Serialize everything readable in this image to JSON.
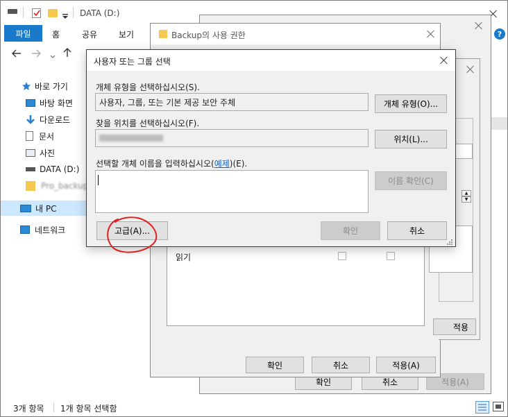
{
  "explorer": {
    "title": "DATA (D:)",
    "ribbon_tabs": [
      "파일",
      "홈",
      "공유",
      "보기"
    ],
    "nav": {
      "quick_access": "바로 가기",
      "desktop": "바탕 화면",
      "downloads": "다운로드",
      "documents": "문서",
      "pictures": "사진",
      "data_drive": "DATA (D:)",
      "backup_folder": "Pro_backup",
      "this_pc": "내 PC",
      "network": "네트워크"
    },
    "status": {
      "items": "3개 항목",
      "selected": "1개 항목 선택함"
    }
  },
  "back_window": {
    "ok": "확인",
    "cancel": "취소",
    "apply": "적용(A)"
  },
  "perm_dialog": {
    "title": "Backup의 사용 권한",
    "read_label": "읽기",
    "apply_inner": "적용",
    "ok": "확인",
    "cancel": "취소",
    "apply": "적용(A)"
  },
  "select_dialog": {
    "title": "사용자 또는 그룹 선택",
    "object_type_label": "개체 유형을 선택하십시오(S).",
    "object_type_value": "사용자, 그룹, 또는 기본 제공 보안 주체",
    "object_type_button": "개체 유형(O)...",
    "location_label": "찾을 위치를 선택하십시오(F).",
    "location_value": "",
    "location_button": "위치(L)...",
    "names_label_prefix": "선택할 개체 이름을 입력하십시오(",
    "names_label_link": "예제",
    "names_label_suffix": ")(E).",
    "names_value": "",
    "check_names_button": "이름 확인(C)",
    "advanced_button": "고급(A)...",
    "ok_button": "확인",
    "cancel_button": "취소"
  },
  "colors": {
    "accent": "#1979ca",
    "link": "#0066cc",
    "annotation": "#e02020",
    "selection": "#cce8ff"
  }
}
